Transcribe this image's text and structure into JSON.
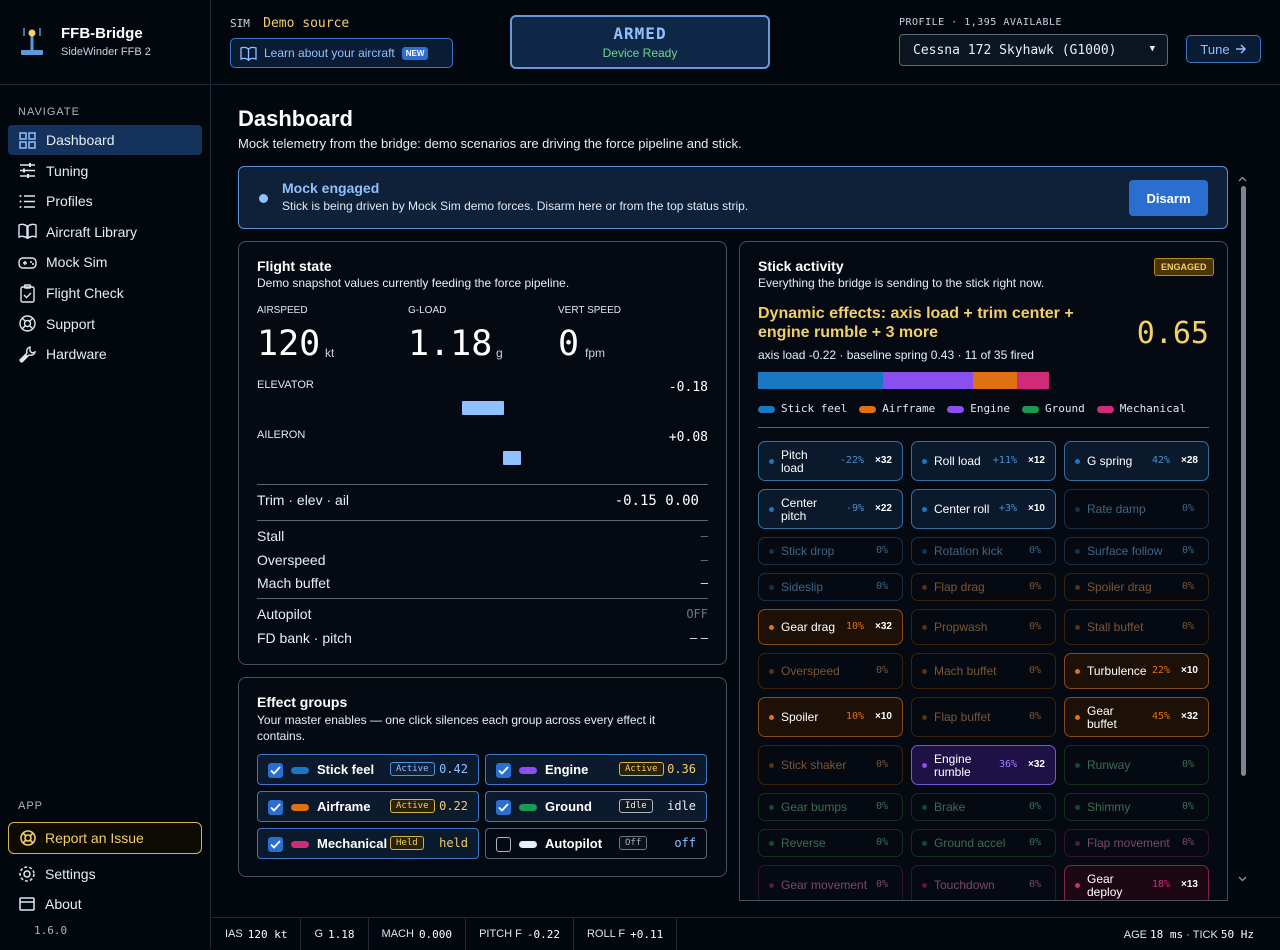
{
  "app": {
    "title": "FFB-Bridge",
    "device": "SideWinder FFB 2",
    "version": "1.6.0"
  },
  "nav": {
    "heading": "NAVIGATE",
    "items": [
      {
        "label": "Dashboard",
        "icon": "grid-icon",
        "active": true
      },
      {
        "label": "Tuning",
        "icon": "sliders-icon"
      },
      {
        "label": "Profiles",
        "icon": "list-icon"
      },
      {
        "label": "Aircraft Library",
        "icon": "book-icon"
      },
      {
        "label": "Mock Sim",
        "icon": "gamepad-icon"
      },
      {
        "label": "Flight Check",
        "icon": "clipboard-check-icon"
      },
      {
        "label": "Support",
        "icon": "lifebuoy-icon"
      },
      {
        "label": "Hardware",
        "icon": "wrench-icon"
      }
    ],
    "app_heading": "APP",
    "report": "Report an Issue",
    "settings": "Settings",
    "about": "About"
  },
  "top": {
    "sim_label": "SIM",
    "sim_source": "Demo source",
    "learn": "Learn about your aircraft",
    "learn_badge": "NEW",
    "armed_title": "ARMED",
    "armed_sub": "Device Ready",
    "profile_label": "PROFILE · 1,395 AVAILABLE",
    "profile_value": "Cessna 172 Skyhawk (G1000)",
    "tune": "Tune"
  },
  "page": {
    "title": "Dashboard",
    "subtitle": "Mock telemetry from the bridge: demo scenarios are driving the force pipeline and stick."
  },
  "banner": {
    "title": "Mock engaged",
    "desc": "Stick is being driven by Mock Sim demo forces. Disarm here or from the top status strip.",
    "button": "Disarm"
  },
  "flight": {
    "title": "Flight state",
    "subtitle": "Demo snapshot values currently feeding the force pipeline.",
    "airspeed": {
      "label": "AIRSPEED",
      "value": "120",
      "unit": "kt"
    },
    "gload": {
      "label": "G-LOAD",
      "value": "1.18",
      "unit": "g"
    },
    "vs": {
      "label": "VERT SPEED",
      "value": "0",
      "unit": "fpm"
    },
    "elevator": {
      "label": "ELEVATOR",
      "value": "-0.18",
      "level": -0.18
    },
    "aileron": {
      "label": "AILERON",
      "value": "+0.08",
      "level": 0.08
    },
    "trim_label": "Trim · elev · ail",
    "trim_value": "-0.15 0.00",
    "stall": {
      "label": "Stall",
      "value": "–"
    },
    "overspeed": {
      "label": "Overspeed",
      "value": "–"
    },
    "mach": {
      "label": "Mach buffet",
      "value": "–"
    },
    "autopilot": {
      "label": "Autopilot",
      "value": "OFF"
    },
    "fd": {
      "label": "FD bank · pitch",
      "value": "– –"
    }
  },
  "groups": {
    "title": "Effect groups",
    "subtitle": "Your master enables — one click silences each group across every effect it contains.",
    "items": [
      {
        "name": "Stick feel",
        "badge": "Active",
        "value": "0.42",
        "checked": true,
        "color": "#1a78c2",
        "state": "active"
      },
      {
        "name": "Engine",
        "badge": "Active",
        "value": "0.36",
        "checked": true,
        "color": "#8a4ff0",
        "state": "active-warm"
      },
      {
        "name": "Airframe",
        "badge": "Active",
        "value": "0.22",
        "checked": true,
        "color": "#e07010",
        "state": "active-warm"
      },
      {
        "name": "Ground",
        "badge": "Idle",
        "value": "idle",
        "checked": true,
        "color": "#1a9a55",
        "state": "idle"
      },
      {
        "name": "Mechanical",
        "badge": "Held",
        "value": "held",
        "checked": true,
        "color": "#d02a7a",
        "state": "held"
      },
      {
        "name": "Autopilot",
        "badge": "Off",
        "value": "off",
        "checked": false,
        "color": "#e6edf6",
        "state": "off"
      }
    ]
  },
  "stick": {
    "title": "Stick activity",
    "subtitle": "Everything the bridge is sending to the stick right now.",
    "badge": "ENGAGED",
    "dyn_title": "Dynamic effects: axis load + trim center + engine rumble + 3 more",
    "dyn_value": "0.65",
    "dyn_sub": "axis load -0.22 · baseline spring 0.43 · 11 of 35 fired",
    "mix": [
      {
        "name": "Stick feel",
        "share": 0.43,
        "color": "#1a78c2"
      },
      {
        "name": "Engine",
        "share": 0.31,
        "color": "#8a4ff0"
      },
      {
        "name": "Airframe",
        "share": 0.15,
        "color": "#e07010"
      },
      {
        "name": "Mechanical",
        "share": 0.11,
        "color": "#d02a7a"
      }
    ],
    "legend": [
      {
        "name": "Stick feel",
        "color": "#1a78c2"
      },
      {
        "name": "Airframe",
        "color": "#e07010"
      },
      {
        "name": "Engine",
        "color": "#8a4ff0"
      },
      {
        "name": "Ground",
        "color": "#1a9a55"
      },
      {
        "name": "Mechanical",
        "color": "#d02a7a"
      }
    ],
    "effects": [
      {
        "name": "Pitch load",
        "pct": "-22%",
        "count": "×32",
        "group": "stick",
        "on": true
      },
      {
        "name": "Roll load",
        "pct": "+11%",
        "count": "×12",
        "group": "stick",
        "on": true
      },
      {
        "name": "G spring",
        "pct": "42%",
        "count": "×28",
        "group": "stick",
        "on": true
      },
      {
        "name": "Center pitch",
        "pct": "-9%",
        "count": "×22",
        "group": "stick",
        "on": true
      },
      {
        "name": "Center roll",
        "pct": "+3%",
        "count": "×10",
        "group": "stick",
        "on": true
      },
      {
        "name": "Rate damp",
        "pct": "0%",
        "count": "",
        "group": "stick",
        "on": false
      },
      {
        "name": "Stick drop",
        "pct": "0%",
        "count": "",
        "group": "stick",
        "on": false
      },
      {
        "name": "Rotation kick",
        "pct": "0%",
        "count": "",
        "group": "stick",
        "on": false
      },
      {
        "name": "Surface follow",
        "pct": "0%",
        "count": "",
        "group": "stick",
        "on": false
      },
      {
        "name": "Sideslip",
        "pct": "0%",
        "count": "",
        "group": "stick",
        "on": false
      },
      {
        "name": "Flap drag",
        "pct": "0%",
        "count": "",
        "group": "air",
        "on": false
      },
      {
        "name": "Spoiler drag",
        "pct": "0%",
        "count": "",
        "group": "air",
        "on": false
      },
      {
        "name": "Gear drag",
        "pct": "10%",
        "count": "×32",
        "group": "air",
        "on": true
      },
      {
        "name": "Propwash",
        "pct": "0%",
        "count": "",
        "group": "air",
        "on": false
      },
      {
        "name": "Stall buffet",
        "pct": "0%",
        "count": "",
        "group": "air",
        "on": false
      },
      {
        "name": "Overspeed",
        "pct": "0%",
        "count": "",
        "group": "air",
        "on": false
      },
      {
        "name": "Mach buffet",
        "pct": "0%",
        "count": "",
        "group": "air",
        "on": false
      },
      {
        "name": "Turbulence",
        "pct": "22%",
        "count": "×10",
        "group": "air",
        "on": true
      },
      {
        "name": "Spoiler",
        "pct": "10%",
        "count": "×10",
        "group": "air",
        "on": true
      },
      {
        "name": "Flap buffet",
        "pct": "0%",
        "count": "",
        "group": "air",
        "on": false
      },
      {
        "name": "Gear buffet",
        "pct": "45%",
        "count": "×32",
        "group": "air",
        "on": true
      },
      {
        "name": "Stick shaker",
        "pct": "0%",
        "count": "",
        "group": "air",
        "on": false
      },
      {
        "name": "Engine rumble",
        "pct": "36%",
        "count": "×32",
        "group": "engine",
        "on": true
      },
      {
        "name": "Runway",
        "pct": "0%",
        "count": "",
        "group": "ground",
        "on": false
      },
      {
        "name": "Gear bumps",
        "pct": "0%",
        "count": "",
        "group": "ground",
        "on": false
      },
      {
        "name": "Brake",
        "pct": "0%",
        "count": "",
        "group": "ground",
        "on": false
      },
      {
        "name": "Shimmy",
        "pct": "0%",
        "count": "",
        "group": "ground",
        "on": false
      },
      {
        "name": "Reverse",
        "pct": "0%",
        "count": "",
        "group": "ground",
        "on": false
      },
      {
        "name": "Ground accel",
        "pct": "0%",
        "count": "",
        "group": "ground",
        "on": false
      },
      {
        "name": "Flap movement",
        "pct": "0%",
        "count": "",
        "group": "mech",
        "on": false
      },
      {
        "name": "Gear movement",
        "pct": "0%",
        "count": "",
        "group": "mech",
        "on": false
      },
      {
        "name": "Touchdown",
        "pct": "0%",
        "count": "",
        "group": "mech",
        "on": false
      },
      {
        "name": "Gear deploy",
        "pct": "18%",
        "count": "×13",
        "group": "mech",
        "on": true
      }
    ]
  },
  "status": {
    "ias_label": "IAS",
    "ias": "120 kt",
    "g_label": "G",
    "g": "1.18",
    "mach_label": "MACH",
    "mach": "0.000",
    "pitchf_label": "PITCH F",
    "pitchf": "-0.22",
    "rollf_label": "ROLL F",
    "rollf": "+0.11",
    "age_label": "AGE",
    "age": "18 ms",
    "tick_label": "TICK",
    "tick": "50 Hz"
  }
}
